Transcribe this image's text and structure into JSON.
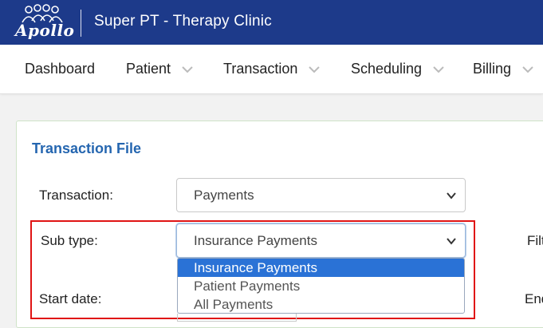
{
  "header": {
    "logo_text": "Apollo",
    "clinic_name": "Super PT - Therapy Clinic"
  },
  "nav": {
    "items": [
      {
        "label": "Dashboard",
        "has_menu": false
      },
      {
        "label": "Patient",
        "has_menu": true
      },
      {
        "label": "Transaction",
        "has_menu": true
      },
      {
        "label": "Scheduling",
        "has_menu": true
      },
      {
        "label": "Billing",
        "has_menu": true
      }
    ]
  },
  "form": {
    "title": "Transaction File",
    "transaction_label": "Transaction:",
    "transaction_value": "Payments",
    "subtype_label": "Sub type:",
    "subtype_value": "Insurance Payments",
    "subtype_options": [
      "Insurance Payments",
      "Patient Payments",
      "All Payments"
    ],
    "subtype_selected_index": 0,
    "start_date_label": "Start date:",
    "filter_label_partial": "Filt",
    "end_label_partial": "End"
  },
  "colors": {
    "header_bg": "#1d3a8a",
    "title_blue": "#2566b0",
    "highlight_border": "#e01414",
    "option_selected": "#2a72d6"
  }
}
